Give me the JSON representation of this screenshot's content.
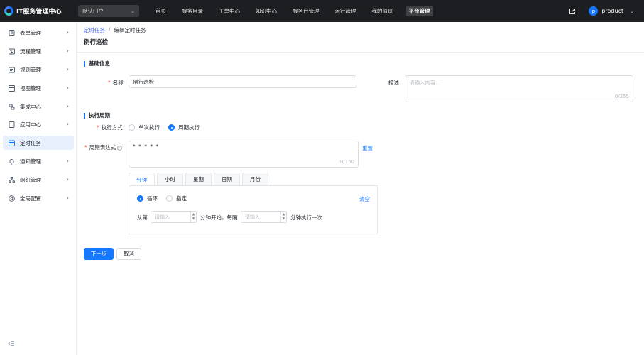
{
  "app": {
    "title": "IT服务管理中心"
  },
  "portal": {
    "selected": "默认门户"
  },
  "topnav": [
    "首页",
    "服务目录",
    "工单中心",
    "知识中心",
    "服务台管理",
    "运行管理",
    "我的值班",
    "平台管理"
  ],
  "user": {
    "avatar_letter": "p",
    "name": "product"
  },
  "sidebar": {
    "items": [
      {
        "label": "表单管理",
        "icon": "form-icon"
      },
      {
        "label": "流程管理",
        "icon": "flow-icon"
      },
      {
        "label": "规则管理",
        "icon": "rule-icon"
      },
      {
        "label": "视图管理",
        "icon": "view-icon"
      },
      {
        "label": "集成中心",
        "icon": "integration-icon"
      },
      {
        "label": "应用中心",
        "icon": "app-icon"
      },
      {
        "label": "定时任务",
        "icon": "schedule-icon"
      },
      {
        "label": "通知管理",
        "icon": "bell-icon"
      },
      {
        "label": "组织管理",
        "icon": "org-icon"
      },
      {
        "label": "全局配置",
        "icon": "settings-icon"
      }
    ]
  },
  "breadcrumb": {
    "parent": "定时任务",
    "separator": "/",
    "current": "编辑定时任务"
  },
  "page": {
    "title": "例行巡检"
  },
  "basic": {
    "section_title": "基础信息",
    "name_label": "名称",
    "name_value": "例行巡检",
    "desc_label": "描述",
    "desc_placeholder": "请输入内容...",
    "desc_count": "0/255"
  },
  "period": {
    "section_title": "执行周期",
    "mode_label": "执行方式",
    "mode_once": "单次执行",
    "mode_periodic": "周期执行",
    "expr_label": "周期表达式",
    "expr_value": "* * * * *",
    "expr_count": "0/150",
    "reset": "重置",
    "tabs": [
      "分钟",
      "小时",
      "星期",
      "日期",
      "月份"
    ],
    "loop": "循环",
    "specify": "指定",
    "clear": "清空",
    "from": "从第",
    "start_placeholder": "请输入",
    "start_suffix": "分钟开始，每隔",
    "interval_placeholder": "请输入",
    "interval_suffix": "分钟执行一次"
  },
  "actions": {
    "next": "下一步",
    "cancel": "取消"
  },
  "colors": {
    "accent": "#1677ff",
    "topbar": "#1d1e21",
    "required": "#f53f3f"
  }
}
